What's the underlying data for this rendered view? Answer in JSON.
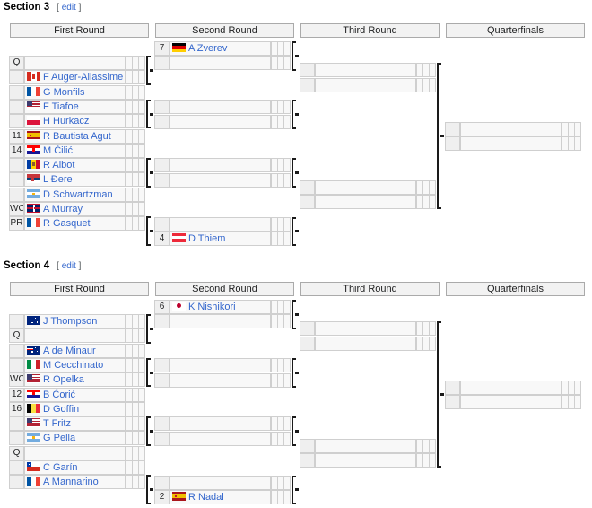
{
  "colors": {
    "link": "#3366cc",
    "header_bg": "#f2f2f2",
    "header_border": "#aaaaaa",
    "cell_bg": "#f8f8f8",
    "cell_border": "#cfcfcf",
    "seed_bg": "#efefef",
    "connector": "#1a1a1a"
  },
  "rounds": {
    "r1": "First Round",
    "r2": "Second Round",
    "r3": "Third Round",
    "qf": "Quarterfinals"
  },
  "edit_label": "edit",
  "bracket_open": "[",
  "bracket_close": "]",
  "sections": [
    {
      "title": "Section 3",
      "first_round": [
        {
          "seed": "Q",
          "flag": "",
          "name": ""
        },
        {
          "seed": "",
          "flag": "CAN",
          "name": "F Auger-Aliassime"
        },
        {
          "seed": "",
          "flag": "FRA",
          "name": "G Monfils"
        },
        {
          "seed": "",
          "flag": "USA",
          "name": "F Tiafoe"
        },
        {
          "seed": "",
          "flag": "POL",
          "name": "H Hurkacz"
        },
        {
          "seed": "11",
          "flag": "ESP",
          "name": "R Bautista Agut"
        },
        {
          "seed": "14",
          "flag": "CRO",
          "name": "M Čilić"
        },
        {
          "seed": "",
          "flag": "MDA",
          "name": "R Albot"
        },
        {
          "seed": "",
          "flag": "SRB",
          "name": "L Đere"
        },
        {
          "seed": "",
          "flag": "ARG",
          "name": "D Schwartzman"
        },
        {
          "seed": "WC",
          "flag": "GBR",
          "name": "A Murray"
        },
        {
          "seed": "PR",
          "flag": "FRA",
          "name": "R Gasquet"
        }
      ],
      "second_round": [
        {
          "seed": "7",
          "flag": "GER",
          "name": "A Zverev"
        },
        {
          "seed": "",
          "flag": "",
          "name": ""
        },
        {
          "seed": "",
          "flag": "",
          "name": ""
        },
        {
          "seed": "",
          "flag": "",
          "name": ""
        },
        {
          "seed": "",
          "flag": "",
          "name": ""
        },
        {
          "seed": "",
          "flag": "",
          "name": ""
        },
        {
          "seed": "",
          "flag": "",
          "name": ""
        },
        {
          "seed": "4",
          "flag": "AUT",
          "name": "D Thiem"
        }
      ],
      "third_round": [
        {
          "seed": "",
          "flag": "",
          "name": ""
        },
        {
          "seed": "",
          "flag": "",
          "name": ""
        },
        {
          "seed": "",
          "flag": "",
          "name": ""
        },
        {
          "seed": "",
          "flag": "",
          "name": ""
        }
      ],
      "quarterfinals": [
        {
          "seed": "",
          "flag": "",
          "name": ""
        },
        {
          "seed": "",
          "flag": "",
          "name": ""
        }
      ]
    },
    {
      "title": "Section 4",
      "first_round": [
        {
          "seed": "",
          "flag": "AUS",
          "name": "J Thompson"
        },
        {
          "seed": "Q",
          "flag": "",
          "name": ""
        },
        {
          "seed": "",
          "flag": "AUS",
          "name": "A de Minaur"
        },
        {
          "seed": "",
          "flag": "ITA",
          "name": "M Cecchinato"
        },
        {
          "seed": "WC",
          "flag": "USA",
          "name": "R Opelka"
        },
        {
          "seed": "12",
          "flag": "CRO",
          "name": "B Ćorić"
        },
        {
          "seed": "16",
          "flag": "BEL",
          "name": "D Goffin"
        },
        {
          "seed": "",
          "flag": "USA",
          "name": "T Fritz"
        },
        {
          "seed": "",
          "flag": "ARG",
          "name": "G Pella"
        },
        {
          "seed": "Q",
          "flag": "",
          "name": ""
        },
        {
          "seed": "",
          "flag": "CHI",
          "name": "C Garín"
        },
        {
          "seed": "",
          "flag": "FRA",
          "name": "A Mannarino"
        }
      ],
      "second_round": [
        {
          "seed": "6",
          "flag": "JPN",
          "name": "K Nishikori"
        },
        {
          "seed": "",
          "flag": "",
          "name": ""
        },
        {
          "seed": "",
          "flag": "",
          "name": ""
        },
        {
          "seed": "",
          "flag": "",
          "name": ""
        },
        {
          "seed": "",
          "flag": "",
          "name": ""
        },
        {
          "seed": "",
          "flag": "",
          "name": ""
        },
        {
          "seed": "",
          "flag": "",
          "name": ""
        },
        {
          "seed": "2",
          "flag": "ESP",
          "name": "R Nadal"
        }
      ],
      "third_round": [
        {
          "seed": "",
          "flag": "",
          "name": ""
        },
        {
          "seed": "",
          "flag": "",
          "name": ""
        },
        {
          "seed": "",
          "flag": "",
          "name": ""
        },
        {
          "seed": "",
          "flag": "",
          "name": ""
        }
      ],
      "quarterfinals": [
        {
          "seed": "",
          "flag": "",
          "name": ""
        },
        {
          "seed": "",
          "flag": "",
          "name": ""
        }
      ]
    }
  ]
}
